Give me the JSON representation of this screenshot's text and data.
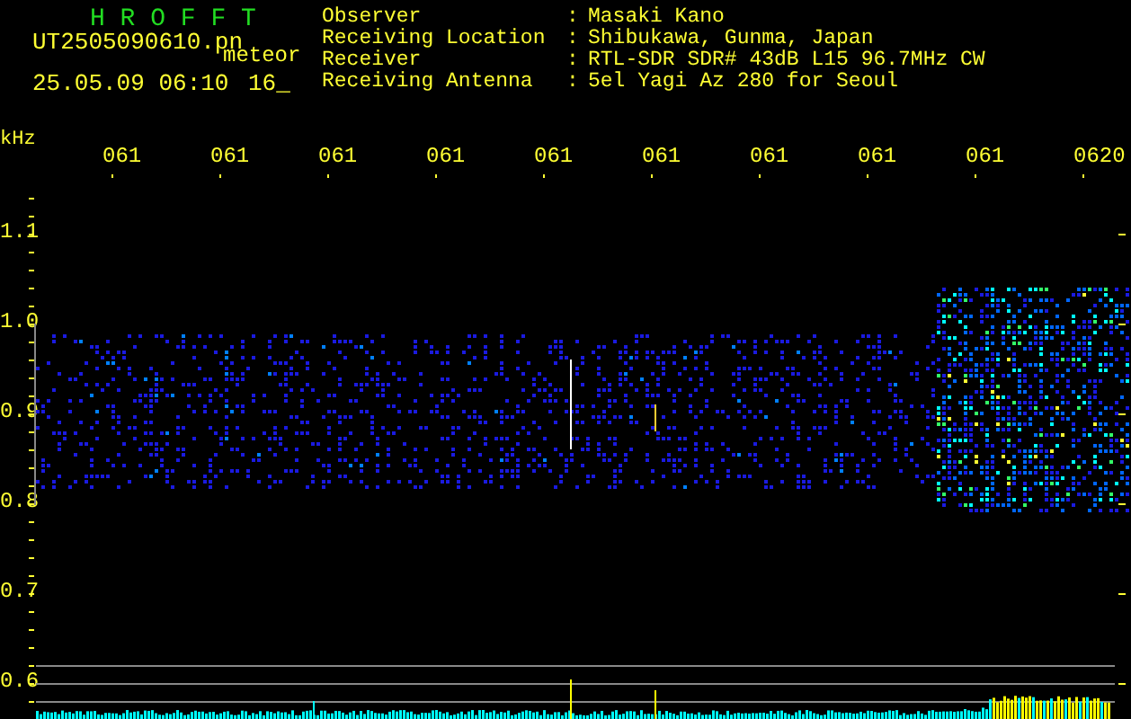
{
  "title": "H R O F F T",
  "file": "UT2505090610.pn",
  "mode": "meteor",
  "datetime": "25.05.09 06:10",
  "counter": "16_",
  "info": [
    {
      "label": "Observer",
      "separator": ":",
      "value": "Masaki Kano"
    },
    {
      "label": "Receiving Location",
      "separator": ":",
      "value": "Shibukawa, Gunma, Japan"
    },
    {
      "label": "Receiver",
      "separator": ":",
      "value": "RTL-SDR SDR# 43dB L15 96.7MHz CW"
    },
    {
      "label": "Receiving Antenna",
      "separator": ":",
      "value": "5el Yagi Az 280 for Seoul"
    }
  ],
  "freq_unit": "kHz",
  "time_labels": [
    "061",
    "061",
    "061",
    "061",
    "061",
    "061",
    "061",
    "061",
    "061",
    "0620"
  ],
  "freq_labels": [
    "1.1",
    "1.0",
    "0.9",
    "0.8",
    "0.7",
    "0.6"
  ]
}
